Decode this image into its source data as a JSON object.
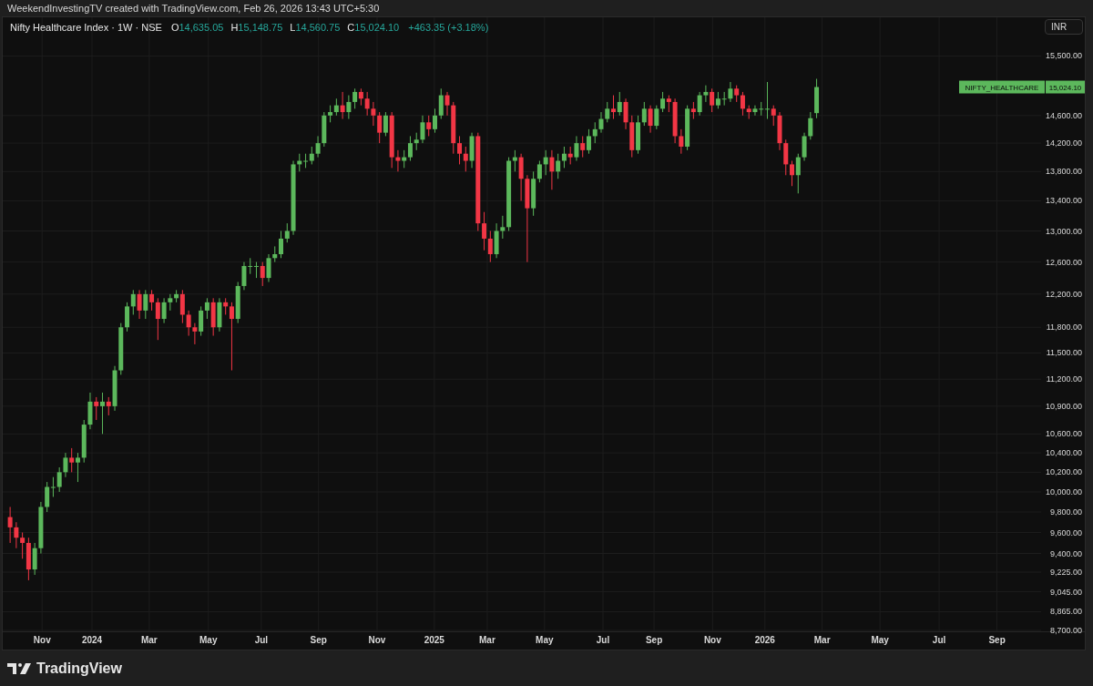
{
  "credit": "WeekendInvestingTV created with TradingView.com, Feb 26, 2026 13:43 UTC+5:30",
  "legend": {
    "symbol": "Nifty Healthcare Index · 1W · NSE",
    "ohlc": [
      {
        "label": "O",
        "value": "14,635.05"
      },
      {
        "label": "H",
        "value": "15,148.75"
      },
      {
        "label": "L",
        "value": "14,560.75"
      },
      {
        "label": "C",
        "value": "15,024.10"
      }
    ],
    "change": "+463.35 (+3.18%)"
  },
  "currency_button": "INR",
  "last_price": {
    "symbol": "NIFTY_HEALTHCARE",
    "value": "15,024.10"
  },
  "candlestick_chart": {
    "kind": "picture",
    "price_axis": [
      "15,500.00",
      "14,600.00",
      "14,200.00",
      "13,800.00",
      "13,400.00",
      "13,000.00",
      "12,600.00",
      "12,200.00",
      "11,800.00",
      "11,500.00",
      "11,200.00",
      "10,900.00",
      "10,600.00",
      "10,400.00",
      "10,200.00",
      "10,000.00",
      "9,800.00",
      "9,600.00",
      "9,400.00",
      "9,225.00",
      "9,045.00",
      "8,865.00",
      "8,700.00"
    ],
    "time_axis": [
      "Nov",
      "2024",
      "Mar",
      "May",
      "Jul",
      "Sep",
      "Nov",
      "2025",
      "Mar",
      "May",
      "Jul",
      "Sep",
      "Nov",
      "2026",
      "Mar",
      "May",
      "Jul",
      "Sep"
    ]
  },
  "footer": {
    "brand": "TradingView"
  }
}
